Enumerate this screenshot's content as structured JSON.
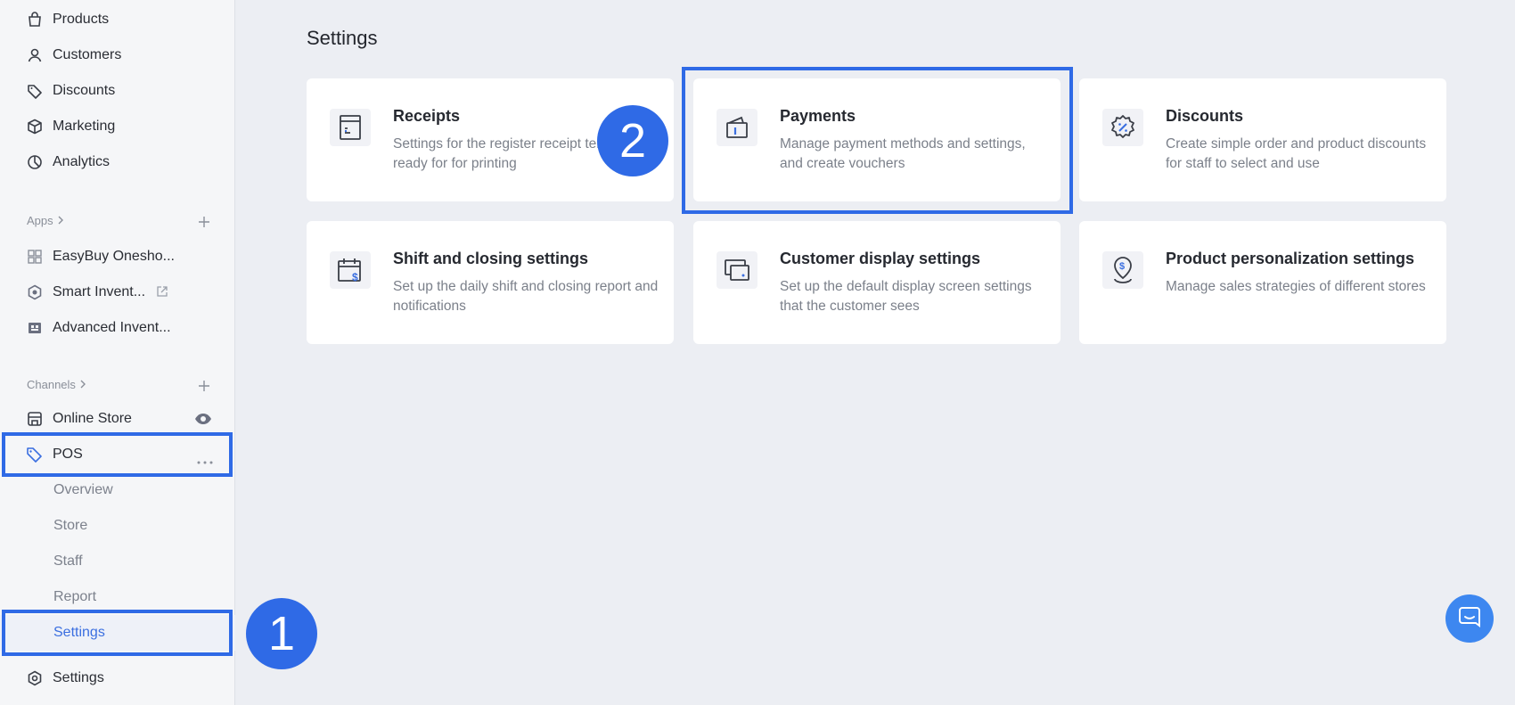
{
  "sidebar": {
    "main_items": [
      {
        "label": "Products",
        "icon": "shopping-bag-icon"
      },
      {
        "label": "Customers",
        "icon": "user-icon"
      },
      {
        "label": "Discounts",
        "icon": "tag-icon"
      },
      {
        "label": "Marketing",
        "icon": "cube-icon"
      },
      {
        "label": "Analytics",
        "icon": "pie-chart-icon"
      }
    ],
    "apps_heading": "Apps",
    "apps": [
      {
        "label": "EasyBuy Onesho...",
        "icon": "grid-app-icon"
      },
      {
        "label": "Smart Invent...",
        "icon": "hexagon-app-icon",
        "external_icon": "external-link-icon"
      },
      {
        "label": "Advanced Invent...",
        "icon": "inventory-app-icon"
      }
    ],
    "channels_heading": "Channels",
    "channels": [
      {
        "label": "Online Store",
        "icon": "storefront-icon",
        "action_icon": "eye-icon"
      },
      {
        "label": "POS",
        "icon": "pos-tag-icon",
        "action_icon": "more-icon"
      }
    ],
    "pos_subitems": [
      "Overview",
      "Store",
      "Staff",
      "Report",
      "Settings"
    ],
    "bottom_settings": "Settings"
  },
  "main": {
    "title": "Settings",
    "cards": [
      {
        "title": "Receipts",
        "desc": "Settings for the register receipt templates ready for for printing"
      },
      {
        "title": "Payments",
        "desc": "Manage payment methods and settings, and create vouchers"
      },
      {
        "title": "Discounts",
        "desc": "Create simple order and product discounts for staff to select and use"
      },
      {
        "title": "Shift and closing settings",
        "desc": "Set up the daily shift and closing report and notifications"
      },
      {
        "title": "Customer display settings",
        "desc": "Set up the default display screen settings that the customer sees"
      },
      {
        "title": "Product personalization settings",
        "desc": "Manage sales strategies of different stores"
      }
    ]
  },
  "annotations": {
    "step1": "1",
    "step2": "2",
    "highlight_color": "#2f6ae6"
  },
  "colors": {
    "accent": "#2f6ae6",
    "active_sub_text": "#3b6fe0",
    "background": "#eceef3"
  }
}
